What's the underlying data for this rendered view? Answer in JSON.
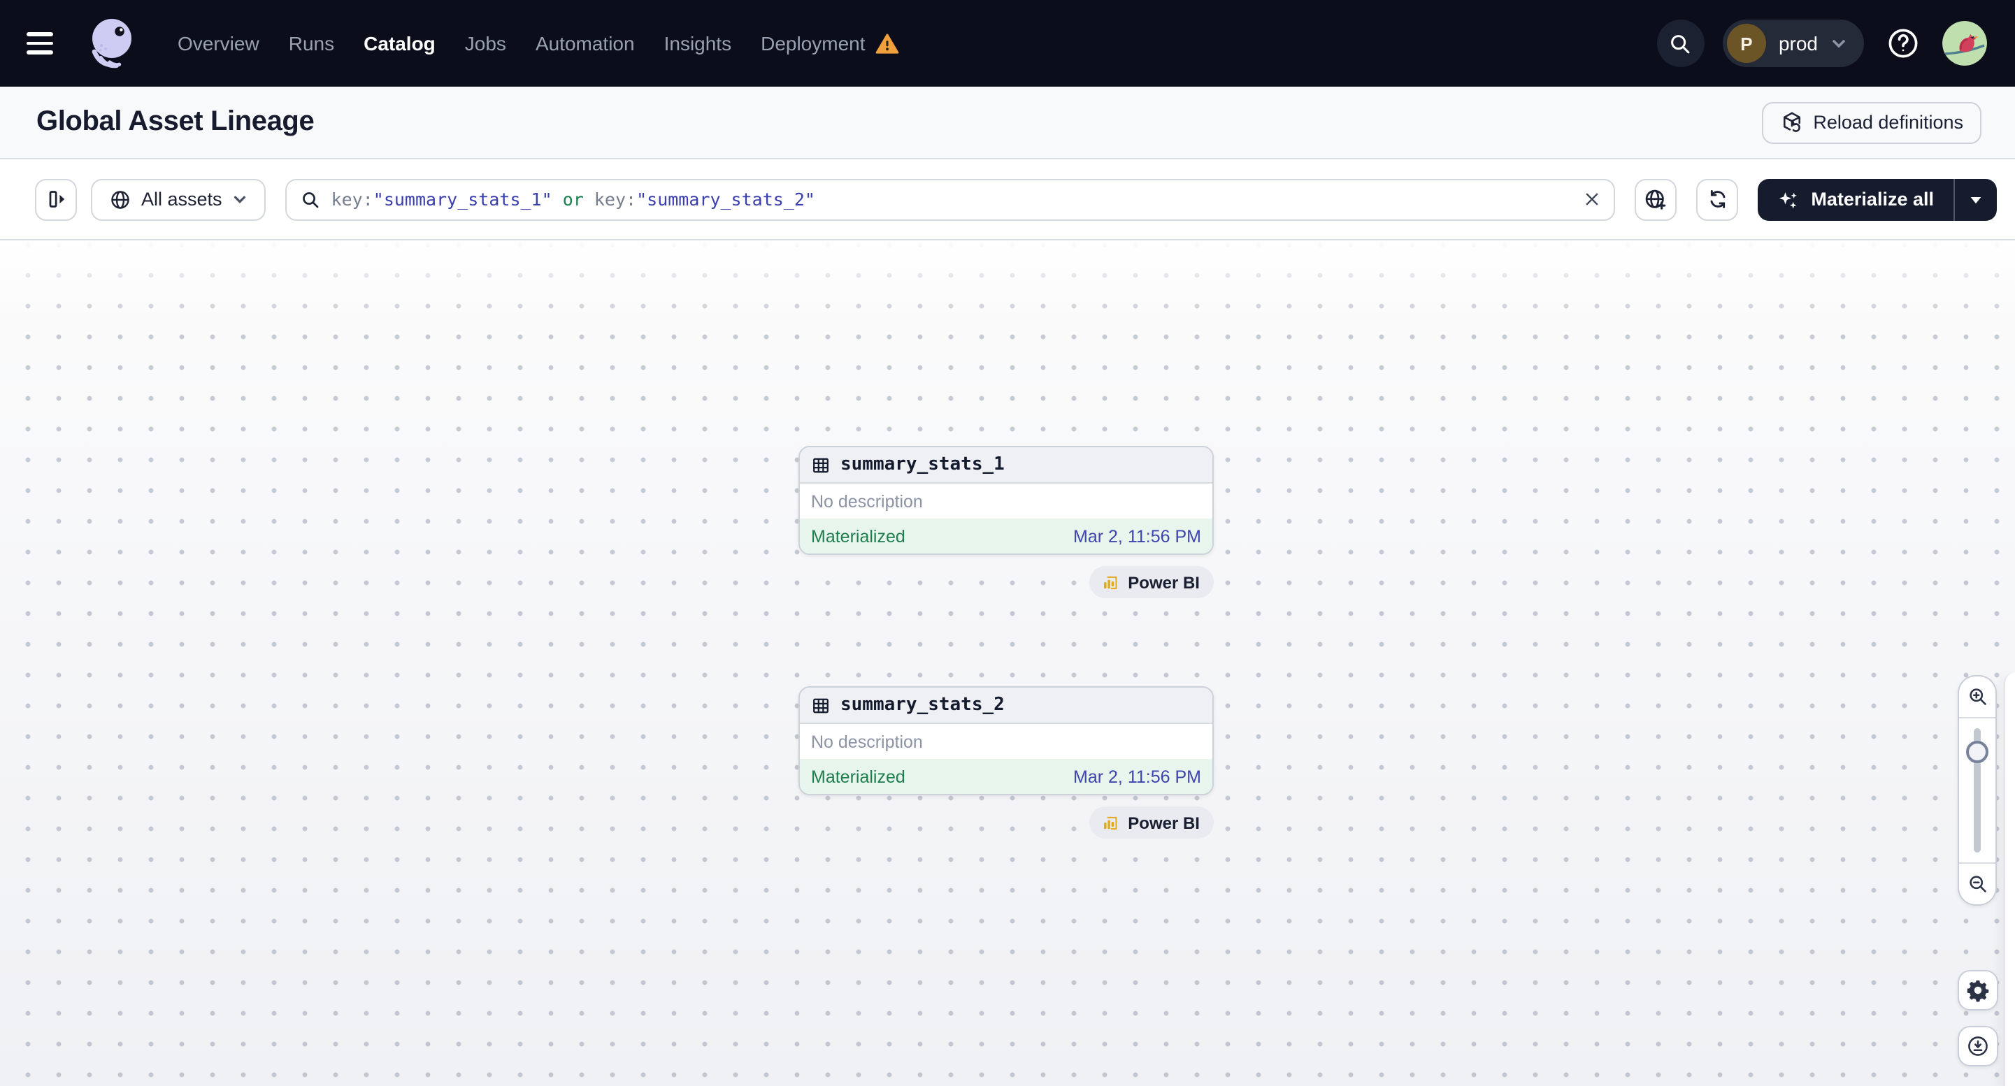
{
  "nav": {
    "menu_items": [
      {
        "label": "Overview",
        "active": false
      },
      {
        "label": "Runs",
        "active": false
      },
      {
        "label": "Catalog",
        "active": true
      },
      {
        "label": "Jobs",
        "active": false
      },
      {
        "label": "Automation",
        "active": false
      },
      {
        "label": "Insights",
        "active": false
      },
      {
        "label": "Deployment",
        "active": false,
        "warning": true
      }
    ],
    "environment": {
      "initial": "P",
      "name": "prod"
    }
  },
  "header": {
    "title": "Global Asset Lineage",
    "reload_button_label": "Reload definitions"
  },
  "toolbar": {
    "asset_filter_label": "All assets",
    "search_query": "key:\"summary_stats_1\" or key:\"summary_stats_2\"",
    "search_tokens": {
      "key1": "key:",
      "value1": "\"summary_stats_1\"",
      "operator": " or ",
      "key2": "key:",
      "value2": "\"summary_stats_2\""
    },
    "materialize_label": "Materialize all"
  },
  "canvas": {
    "nodes": [
      {
        "name": "summary_stats_1",
        "description": "No description",
        "status": "Materialized",
        "last_materialized": "Mar 2, 11:56 PM",
        "tag": "Power BI"
      },
      {
        "name": "summary_stats_2",
        "description": "No description",
        "status": "Materialized",
        "last_materialized": "Mar 2, 11:56 PM",
        "tag": "Power BI"
      }
    ]
  },
  "colors": {
    "nav_background": "#0b0e1a",
    "materialized_green": "#1e7e4e",
    "timestamp_indigo": "#3f45ad",
    "query_value_indigo": "#3a3fae",
    "warning_orange": "#f0a03c",
    "powerbi_yellow": "#e3a81c",
    "materialize_button_dark": "#161c2e"
  }
}
